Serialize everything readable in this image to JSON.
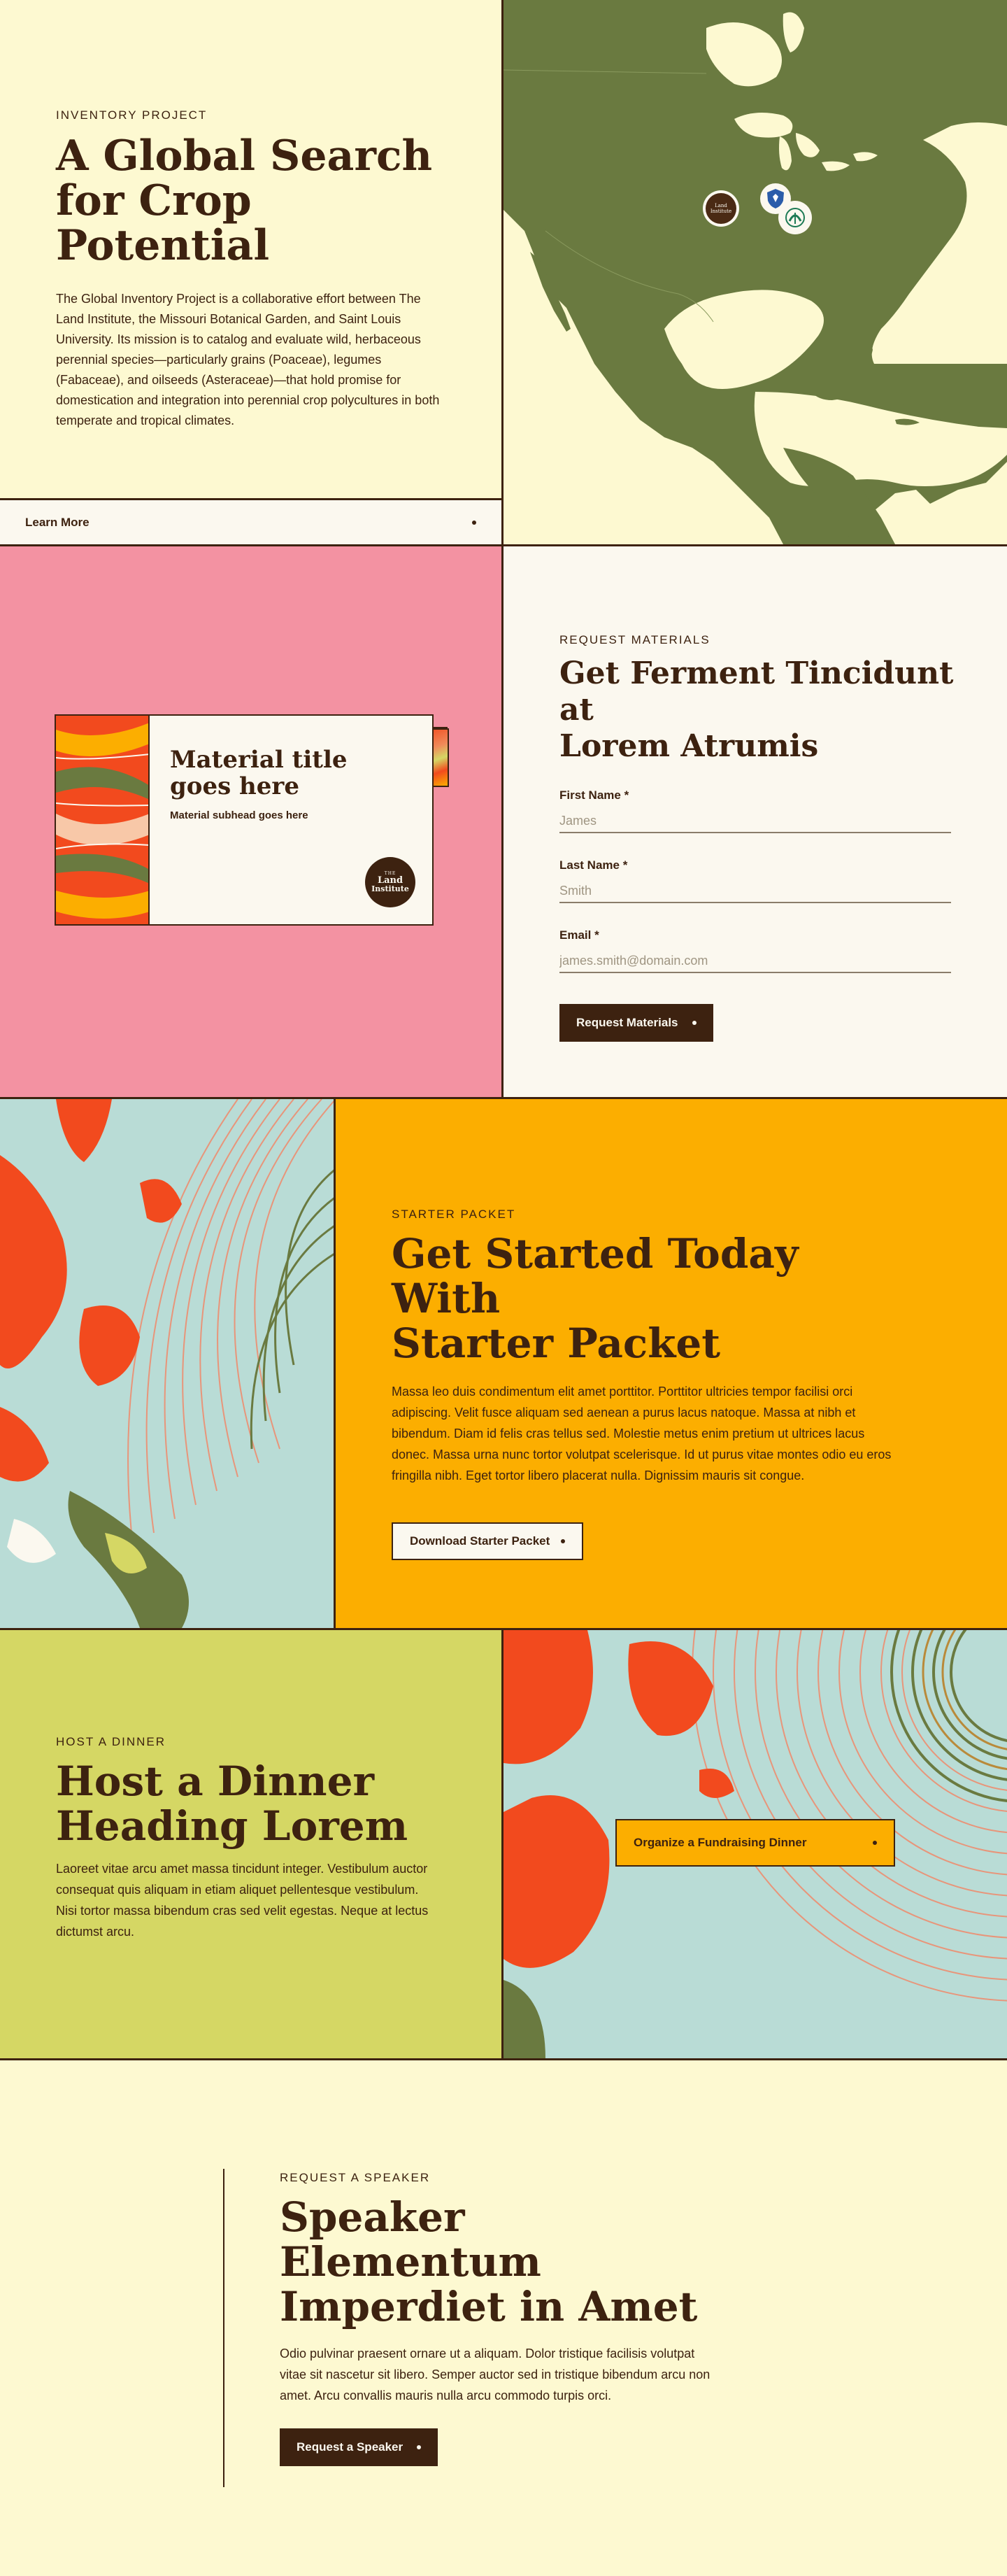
{
  "inventory": {
    "eyebrow": "INVENTORY PROJECT",
    "title_line1": "A Global Search",
    "title_line2": "for Crop Potential",
    "body": "The Global Inventory Project is a collaborative effort between The Land Institute, the Missouri Botanical Garden, and Saint Louis University. Its mission is to catalog and evaluate wild, herbaceous perennial species—particularly grains (Poaceae), legumes (Fabaceae), and oilseeds (Asteraceae)—that hold promise for domestication and integration into perennial crop polycultures in both temperate and tropical climates.",
    "learn_more": "Learn More",
    "map_logo_text": "Land Institute"
  },
  "material": {
    "card_title_line1": "Material title",
    "card_title_line2": "goes here",
    "card_subhead": "Material subhead goes here",
    "badge_small": "THE",
    "badge_line1": "Land",
    "badge_line2": "Institute"
  },
  "request": {
    "eyebrow": "REQUEST MATERIALS",
    "title_line1": "Get Ferment Tincidunt at",
    "title_line2": "Lorem Atrumis",
    "first_name_label": "First Name *",
    "first_name_placeholder": "James",
    "last_name_label": "Last Name *",
    "last_name_placeholder": "Smith",
    "email_label": "Email *",
    "email_placeholder": "james.smith@domain.com",
    "submit_label": "Request Materials"
  },
  "starter": {
    "eyebrow": "STARTER PACKET",
    "title_line1": "Get Started Today With",
    "title_line2": "Starter Packet",
    "body": "Massa leo duis condimentum elit amet porttitor. Porttitor ultricies tempor facilisi orci adipiscing. Velit fusce aliquam sed aenean a purus lacus natoque. Massa at nibh et bibendum. Diam id felis cras tellus sed. Molestie metus enim pretium ut ultrices lacus donec. Massa urna nunc tortor volutpat scelerisque. Id ut purus vitae montes odio eu eros fringilla nibh. Eget tortor libero placerat nulla. Dignissim mauris sit congue.",
    "button": "Download Starter Packet"
  },
  "dinner": {
    "eyebrow": "HOST A DINNER",
    "title_line1": "Host a Dinner",
    "title_line2": "Heading Lorem",
    "body": "Laoreet vitae arcu amet massa tincidunt integer. Vestibulum auctor consequat quis aliquam in etiam aliquet pellentesque vestibulum. Nisi tortor massa bibendum cras sed velit egestas. Neque at lectus dictumst arcu.",
    "button": "Organize a Fundraising Dinner"
  },
  "speaker": {
    "eyebrow": "REQUEST A SPEAKER",
    "title_line1": "Speaker Elementum",
    "title_line2": "Imperdiet in Amet",
    "body": "Odio pulvinar praesent ornare ut a aliquam. Dolor tristique facilisis volutpat vitae sit nascetur sit libero. Semper auctor sed in tristique bibendum arcu non amet. Arcu convallis mauris nulla arcu commodo turpis orci.",
    "button": "Request a Speaker"
  },
  "colors": {
    "brown": "#3d2210",
    "cream": "#fdf9d1",
    "offwhite": "#fbf8ef",
    "pink": "#f392a2",
    "amber": "#fcae00",
    "lime": "#d5d764",
    "map_green": "#6a7a40",
    "red_orange": "#f24a1e",
    "sky": "#b9dcd6"
  },
  "icons": [
    "map-marker-land-institute-icon",
    "map-marker-shield-icon",
    "map-marker-leaf-icon",
    "land-institute-badge-icon"
  ]
}
